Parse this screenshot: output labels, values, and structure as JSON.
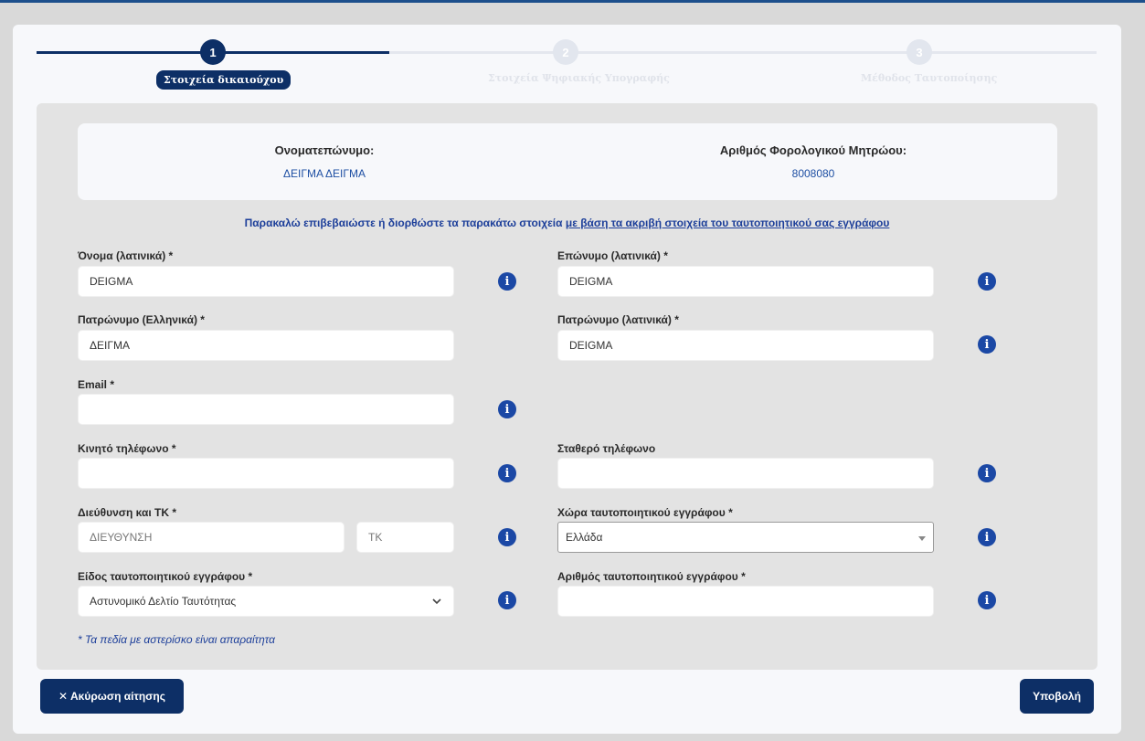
{
  "stepper": {
    "steps": [
      {
        "number": "1",
        "label": "Στοιχεία δικαιούχου",
        "state": "active"
      },
      {
        "number": "2",
        "label": "Στοιχεία Ψηφιακής Υπογραφής",
        "state": "inactive"
      },
      {
        "number": "3",
        "label": "Μέθοδος Ταυτοποίησης",
        "state": "inactive"
      }
    ]
  },
  "summary": {
    "name_label": "Ονοματεπώνυμο:",
    "name_value": "ΔΕΙΓΜΑ ΔΕΙΓΜΑ",
    "afm_label": "Αριθμός Φορολογικού Μητρώου:",
    "afm_value": "8008080"
  },
  "notice": {
    "text": "Παρακαλώ επιβεβαιώστε ή διορθώστε τα παρακάτω στοιχεία ",
    "link": "με βάση τα ακριβή στοιχεία του ταυτοποιητικού σας εγγράφου"
  },
  "form": {
    "first_name": {
      "label": "Όνομα (λατινικά) *",
      "value": "DEIGMA"
    },
    "last_name": {
      "label": "Επώνυμο (λατινικά) *",
      "value": "DEIGMA"
    },
    "father_gr": {
      "label": "Πατρώνυμο (Ελληνικά) *",
      "value": "ΔΕΙΓΜΑ"
    },
    "father_lat": {
      "label": "Πατρώνυμο (λατινικά) *",
      "value": "DEIGMA"
    },
    "email": {
      "label": "Email *",
      "value": ""
    },
    "mobile": {
      "label": "Κινητό τηλέφωνο *",
      "value": ""
    },
    "landline": {
      "label": "Σταθερό τηλέφωνο",
      "value": ""
    },
    "address": {
      "label": "Διεύθυνση και ΤΚ *",
      "placeholder": "ΔΙΕΥΘΥΝΣΗ",
      "zip_placeholder": "ΤΚ"
    },
    "doc_country": {
      "label": "Χώρα ταυτοποιητικού εγγράφου *",
      "value": "Ελλάδα"
    },
    "doc_type": {
      "label": "Είδος ταυτοποιητικού εγγράφου *",
      "value": "Αστυνομικό Δελτίο Ταυτότητας"
    },
    "doc_number": {
      "label": "Αριθμός ταυτοποιητικού εγγράφου *",
      "value": ""
    }
  },
  "footnote": "* Τα πεδία με αστερίσκο είναι απαραίτητα",
  "actions": {
    "cancel_label": "✕  Ακύρωση αίτησης",
    "submit_label": "Υποβολή"
  },
  "icons": {
    "info": "info-circle-icon",
    "chevron": "chevron-down-icon"
  },
  "colors": {
    "primary": "#0d2f66",
    "link": "#1d3f9a",
    "info": "#1b48a5"
  }
}
